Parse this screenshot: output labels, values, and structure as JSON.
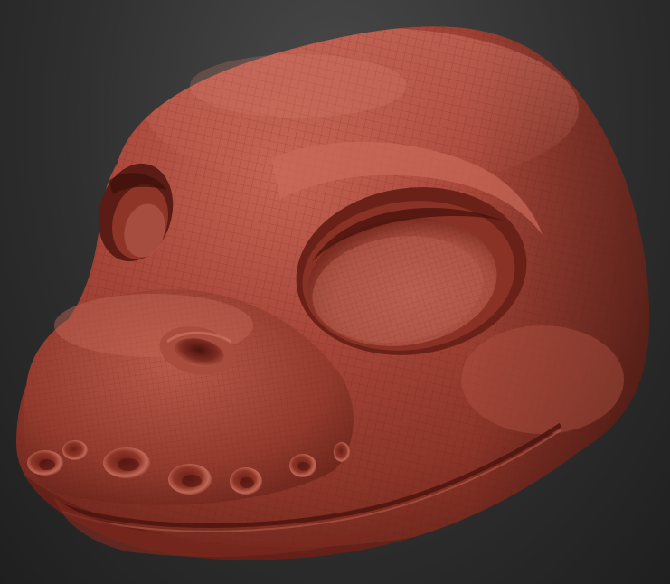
{
  "scene": {
    "subject": "sculpted-creature-head",
    "colors": {
      "background_top": "#4a4a4a",
      "background_bottom": "#1f1f1f",
      "clay_base": "#9b3b2e",
      "clay_light": "#c8685a",
      "clay_shadow": "#5a1c14",
      "clay_deep": "#3a0f0a",
      "wire": "#6e2519"
    }
  }
}
